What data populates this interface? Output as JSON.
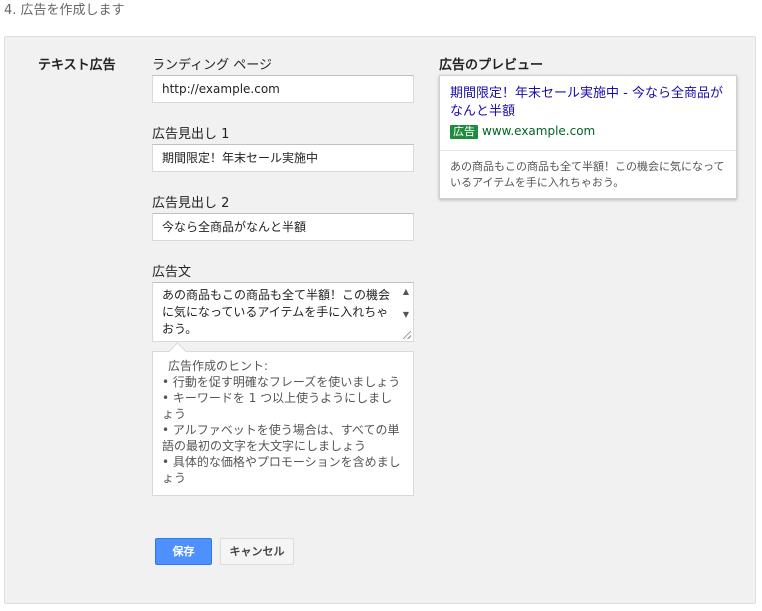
{
  "step_title": "4. 広告を作成します",
  "section_label": "テキスト広告",
  "landing_page": {
    "label": "ランディング ページ",
    "value": "http://example.com"
  },
  "headline1": {
    "label": "広告見出し 1",
    "value": "期間限定！年末セール実施中"
  },
  "headline2": {
    "label": "広告見出し 2",
    "value": "今なら全商品がなんと半額"
  },
  "ad_text": {
    "label": "広告文",
    "value": "あの商品もこの商品も全て半額！この機会に気になっているアイテムを手に入れちゃおう。"
  },
  "hints": {
    "title": "広告作成のヒント:",
    "items": [
      "• 行動を促す明確なフレーズを使いましょう",
      "• キーワードを 1 つ以上使うようにしましょう",
      "• アルファベットを使う場合は、すべての単語の最初の文字を大文字にしましょう",
      "• 具体的な価格やプロモーションを含めましょう"
    ]
  },
  "buttons": {
    "save": "保存",
    "cancel": "キャンセル"
  },
  "preview": {
    "label": "広告のプレビュー",
    "headline": "期間限定！年末セール実施中 - 今なら全商品がなんと半額",
    "badge": "広告",
    "url": "www.example.com",
    "description": "あの商品もこの商品も全て半額！この機会に気になっているアイテムを手に入れちゃおう。"
  },
  "colors": {
    "primary_button": "#4d90fe",
    "link": "#1a0dab",
    "url_green": "#006621",
    "badge_green": "#1e8c3c"
  }
}
